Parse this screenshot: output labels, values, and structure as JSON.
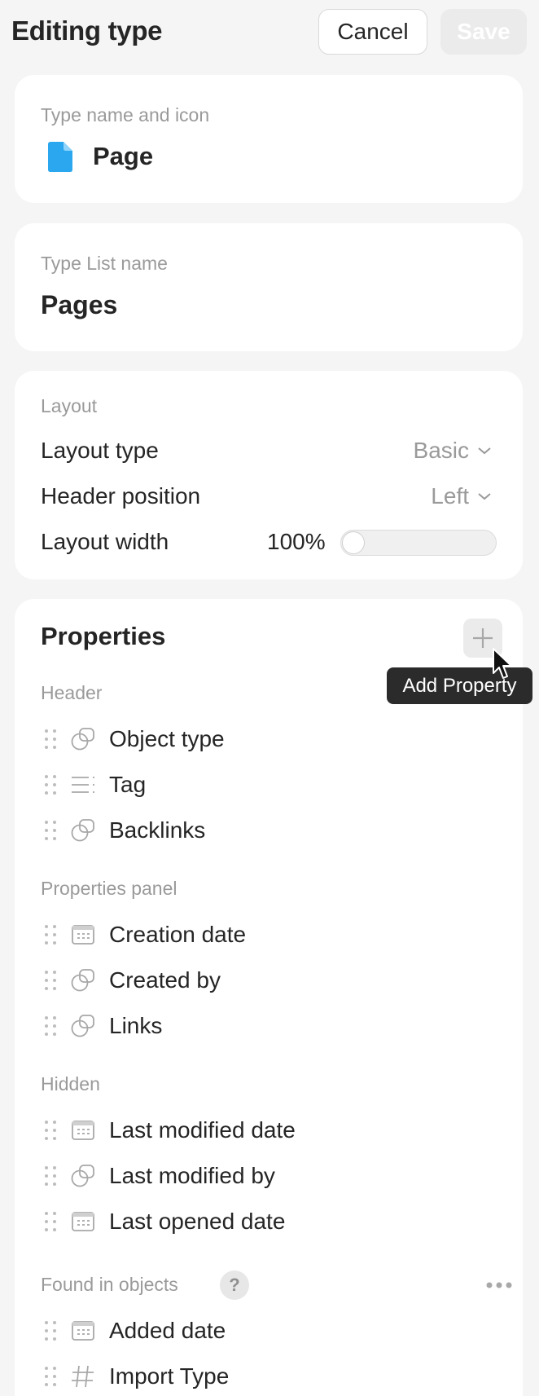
{
  "header": {
    "title": "Editing type",
    "cancel_label": "Cancel",
    "save_label": "Save"
  },
  "type_name": {
    "label": "Type name and icon",
    "value": "Page",
    "icon": "page-document-icon",
    "icon_color": "#2aa7ee"
  },
  "type_list": {
    "label": "Type List name",
    "value": "Pages"
  },
  "layout": {
    "label": "Layout",
    "layout_type_label": "Layout type",
    "layout_type_value": "Basic",
    "header_position_label": "Header position",
    "header_position_value": "Left",
    "layout_width_label": "Layout width",
    "layout_width_value": "100%"
  },
  "properties": {
    "title": "Properties",
    "add_tooltip": "Add Property",
    "groups": [
      {
        "label": "Header",
        "items": [
          {
            "name": "Object type",
            "icon": "object-relation-icon"
          },
          {
            "name": "Tag",
            "icon": "tag-list-icon"
          },
          {
            "name": "Backlinks",
            "icon": "object-relation-icon"
          }
        ]
      },
      {
        "label": "Properties panel",
        "items": [
          {
            "name": "Creation date",
            "icon": "calendar-icon"
          },
          {
            "name": "Created by",
            "icon": "object-relation-icon"
          },
          {
            "name": "Links",
            "icon": "object-relation-icon"
          }
        ]
      },
      {
        "label": "Hidden",
        "items": [
          {
            "name": "Last modified date",
            "icon": "calendar-icon"
          },
          {
            "name": "Last modified by",
            "icon": "object-relation-icon"
          },
          {
            "name": "Last opened date",
            "icon": "calendar-icon"
          }
        ]
      },
      {
        "label": "Found in objects",
        "help_label": "?",
        "items": [
          {
            "name": "Added date",
            "icon": "calendar-icon"
          },
          {
            "name": "Import Type",
            "icon": "number-hash-icon"
          }
        ]
      }
    ]
  },
  "colors": {
    "background": "#f5f5f5",
    "card": "#ffffff",
    "muted_text": "#9a9a9a",
    "tooltip_bg": "#2b2b2b"
  }
}
